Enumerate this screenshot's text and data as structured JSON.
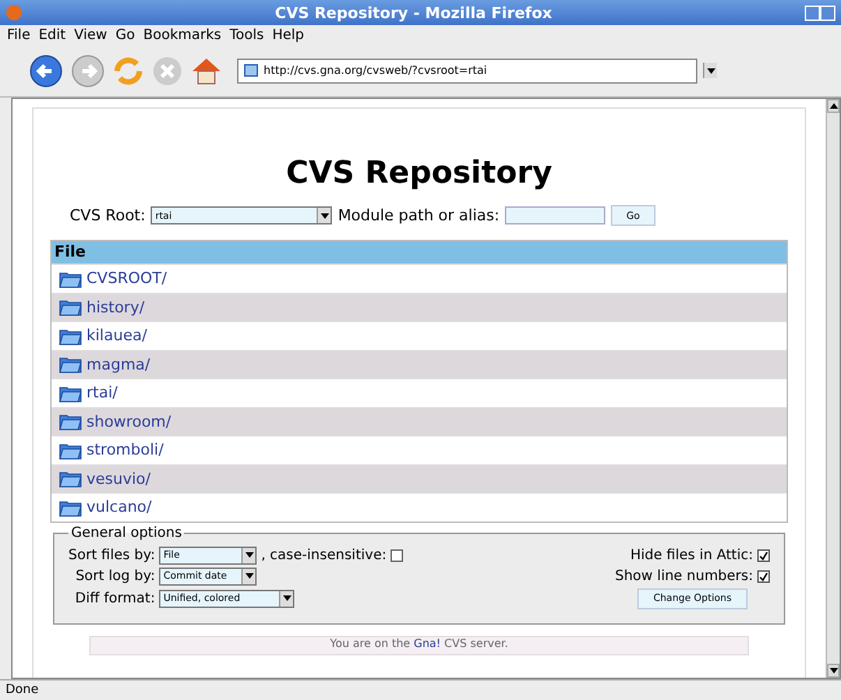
{
  "window": {
    "title": "CVS Repository - Mozilla Firefox"
  },
  "menu": [
    "File",
    "Edit",
    "View",
    "Go",
    "Bookmarks",
    "Tools",
    "Help"
  ],
  "address": {
    "value": "http://cvs.gna.org/cvsweb/?cvsroot=rtai"
  },
  "page": {
    "heading": "CVS Repository",
    "root_label": "CVS Root:",
    "root_value": "rtai",
    "module_label": "Module path or alias:",
    "go": "Go"
  },
  "table": {
    "column": "File",
    "rows": [
      {
        "name": "CVSROOT/"
      },
      {
        "name": "history/"
      },
      {
        "name": "kilauea/"
      },
      {
        "name": "magma/"
      },
      {
        "name": "rtai/"
      },
      {
        "name": "showroom/"
      },
      {
        "name": "stromboli/"
      },
      {
        "name": "vesuvio/"
      },
      {
        "name": "vulcano/"
      }
    ]
  },
  "options": {
    "legend": "General options",
    "sort_files_label": "Sort files by:",
    "sort_files_value": "File",
    "case_label": ", case-insensitive:",
    "case_checked": false,
    "hide_attic_label": "Hide files in Attic:",
    "hide_attic_checked": true,
    "sort_log_label": "Sort log by:",
    "sort_log_value": "Commit date",
    "line_numbers_label": "Show line numbers:",
    "line_numbers_checked": true,
    "diff_label": "Diff format:",
    "diff_value": "Unified, colored",
    "button": "Change Options"
  },
  "footer": {
    "before": "You are on the ",
    "link": "Gna!",
    "after": " CVS server."
  },
  "status_bar": {
    "text": "Done"
  }
}
